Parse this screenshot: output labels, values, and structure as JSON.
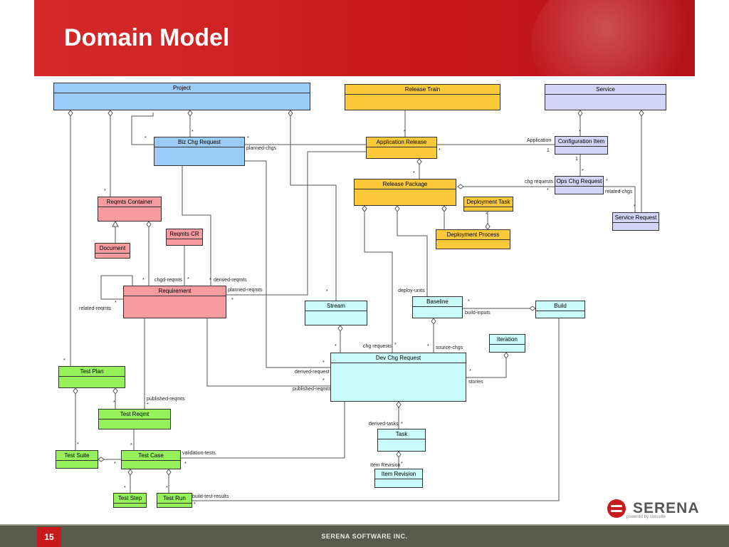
{
  "slide": {
    "title": "Domain Model",
    "page_number": "15",
    "footer": "SERENA SOFTWARE INC.",
    "logo_text": "SERENA",
    "logo_tagline": "powered by swisslife"
  },
  "boxes": {
    "project": "Project",
    "release_train": "Release Train",
    "service": "Service",
    "biz_chg_request": "Biz Chg Request",
    "application_release": "Application Release",
    "configuration_item": "Configuration Item",
    "release_package": "Release Package",
    "ops_chg_request": "Ops Chg Request",
    "deployment_task": "Deployment Task",
    "deployment_process": "Deployment Process",
    "service_request": "Service Request",
    "reqmts_container": "Reqmts Container",
    "document": "Document",
    "reqmts_cr": "Reqmts CR",
    "requirement": "Requirement",
    "stream": "Stream",
    "baseline": "Baseline",
    "build": "Build",
    "iteration": "Iteration",
    "dev_chg_request": "Dev Chg Request",
    "test_plan": "Test Plan",
    "test_reqmt": "Test Reqmt",
    "task": "Task",
    "test_suite": "Test Suite",
    "test_case": "Test Case",
    "item_revision": "Item Revision",
    "test_step": "Test Step",
    "test_run": "Test Run"
  },
  "labels": {
    "planned_chgs": "planned-chgs",
    "application": "Application",
    "one_a": "1",
    "one_b": "1",
    "chg_requests_ops": "chg requests",
    "related_chgs": "related-chgs",
    "chgd_reqmts": "chgd-reqmts",
    "derived_reqmts": "derived-reqmts",
    "planned_reqmts": "planned-reqmts",
    "related_reqmts": "related-reqmts",
    "deploy_units": "deploy-units",
    "build_inputs": "build-inputs",
    "chg_requests_dev": "chg requests",
    "source_chgs": "source-chgs",
    "derived_request": "derived-request",
    "published_reqmts_dev": "published-reqmts",
    "stories": "stories",
    "published_reqmts": "published-reqmts",
    "derived_tasks": "derived-tasks",
    "validation_tests": "validation-tests",
    "item_revision_lbl": "Item Revision",
    "build_test_results": "build-test-results",
    "star": "*"
  }
}
